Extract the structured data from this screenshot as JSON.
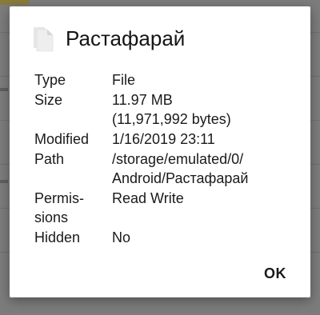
{
  "dialog": {
    "icon": "file-icon",
    "title": "Растафарай",
    "rows": [
      {
        "label": "Type",
        "value": "File"
      },
      {
        "label": "Size",
        "value": "11.97 MB",
        "value2": "(11,971,992 bytes)"
      },
      {
        "label": "Modified",
        "value": "1/16/2019 23:11"
      },
      {
        "label": "Path",
        "value": "/storage/emulated/0/",
        "value2": "Android/Растафарай"
      },
      {
        "label": "Permis-",
        "label2": "sions",
        "value": "Read Write"
      },
      {
        "label": "Hidden",
        "value": "No"
      }
    ],
    "ok_label": "OK"
  },
  "colors": {
    "scrim": "#7c7c7c",
    "dialog_bg": "#ffffff",
    "text": "#1a1a1a"
  }
}
